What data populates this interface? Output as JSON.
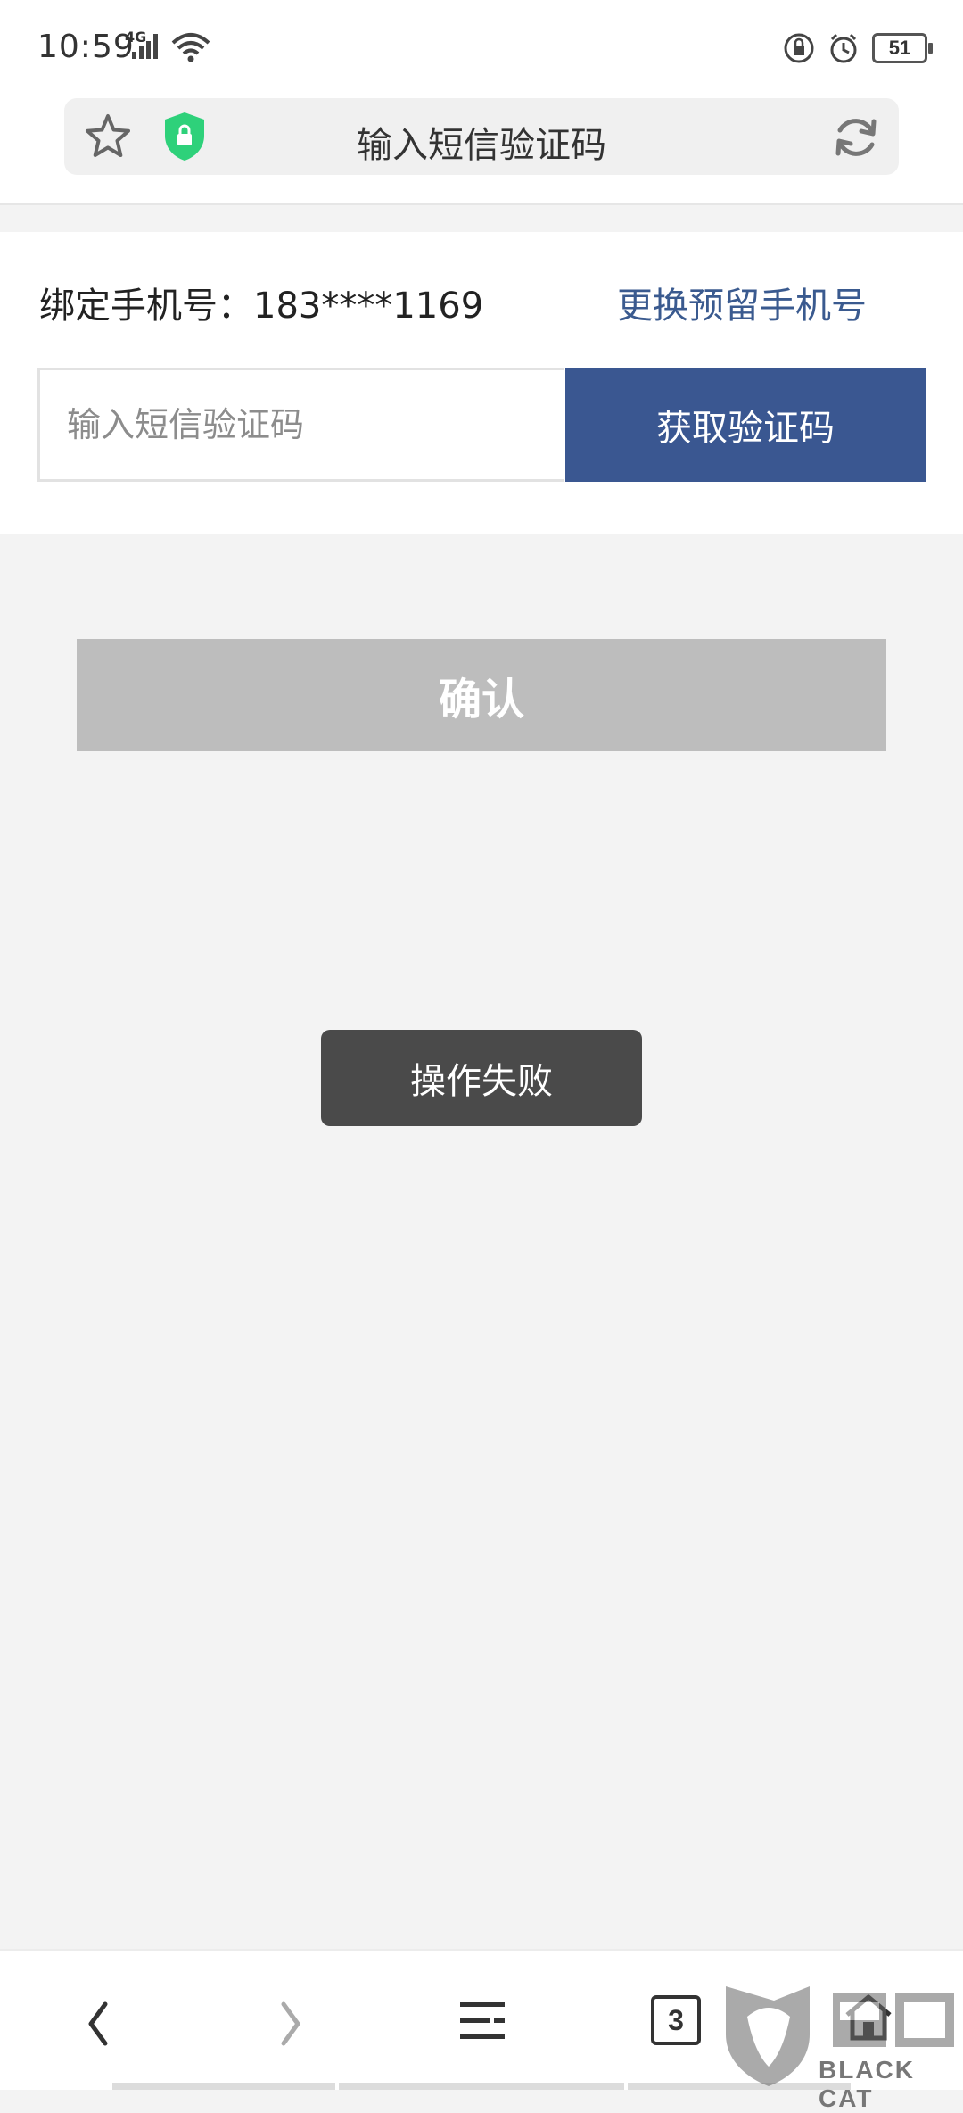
{
  "status_bar": {
    "time": "10:59",
    "network": "4G",
    "battery": "51"
  },
  "browser": {
    "page_title": "输入短信验证码",
    "icons": [
      "star-icon",
      "lock-shield-icon",
      "refresh-icon"
    ]
  },
  "form": {
    "phone_label": "绑定手机号：183****1169",
    "change_phone_link": "更换预留手机号",
    "sms_placeholder": "输入短信验证码",
    "sms_value": "",
    "get_code_button": "获取验证码",
    "confirm_button": "确认"
  },
  "toast": {
    "message": "操作失败"
  },
  "bottom_nav": {
    "tab_count": "3",
    "icons": [
      "back-icon",
      "forward-icon",
      "menu-icon",
      "tabs-icon",
      "home-icon"
    ]
  },
  "watermark": {
    "text": "BLACK CAT"
  },
  "colors": {
    "primary": "#3a5791",
    "link": "#3a5a8f",
    "disabled_button": "#bdbdbd",
    "toast_bg": "#4a4a4a",
    "shield_green": "#2ed17a",
    "page_bg": "#f3f3f3"
  }
}
